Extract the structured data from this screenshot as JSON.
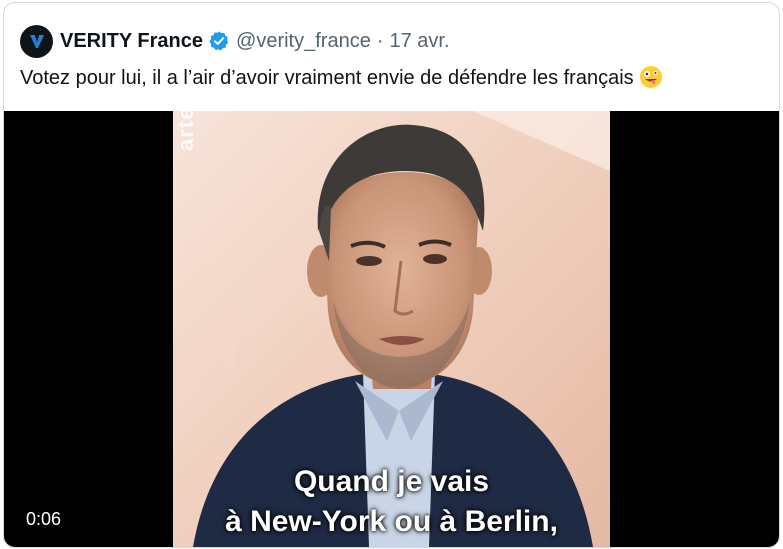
{
  "tweet": {
    "author_name": "VERITY France",
    "handle": "@verity_france",
    "separator": "·",
    "date": "17 avr.",
    "text": "Votez pour lui, il a l’air d’avoir vraiment envie de défendre les français",
    "emoji": "zany-face-emoji",
    "verified_badge_color": "#1d9bf0"
  },
  "video": {
    "watermark": "arte",
    "subtitle_line1": "Quand je vais",
    "subtitle_line2": "à New-York ou à Berlin,",
    "timestamp": "0:06"
  }
}
